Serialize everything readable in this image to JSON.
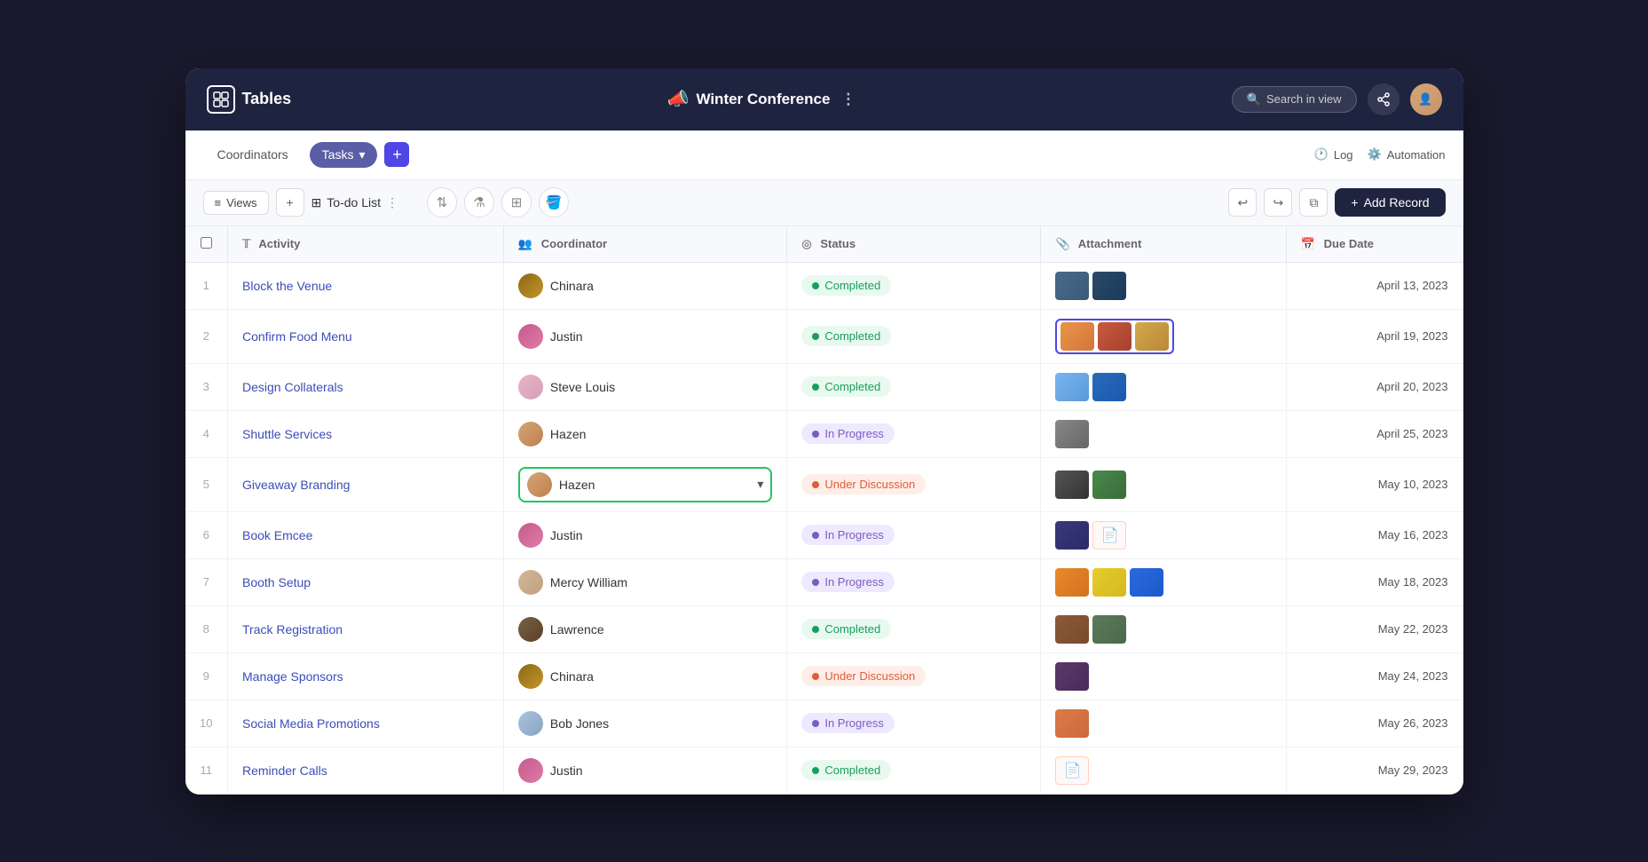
{
  "app": {
    "title": "Tables",
    "window_title": "Winter Conference"
  },
  "header": {
    "title": "Winter Conference",
    "search_placeholder": "Search in view",
    "search_label": "Search in view"
  },
  "tabs": [
    {
      "id": "coordinators",
      "label": "Coordinators",
      "active": false
    },
    {
      "id": "tasks",
      "label": "Tasks",
      "active": true
    }
  ],
  "toolbar_right": {
    "log_label": "Log",
    "automation_label": "Automation"
  },
  "views_toolbar": {
    "views_label": "Views",
    "view_name": "To-do List",
    "add_record_label": "Add Record"
  },
  "table": {
    "columns": [
      {
        "id": "num",
        "label": ""
      },
      {
        "id": "activity",
        "label": "Activity",
        "icon": "T"
      },
      {
        "id": "coordinator",
        "label": "Coordinator",
        "icon": "👤"
      },
      {
        "id": "status",
        "label": "Status",
        "icon": "⊙"
      },
      {
        "id": "attachment",
        "label": "Attachment",
        "icon": "📎"
      },
      {
        "id": "due_date",
        "label": "Due Date",
        "icon": "📅"
      }
    ],
    "rows": [
      {
        "num": 1,
        "activity": "Block the Venue",
        "coordinator": "Chinara",
        "coordinator_avatar": "chinara",
        "status": "Completed",
        "status_type": "completed",
        "attachments": [
          "venue1",
          "venue2"
        ],
        "due_date": "April 13, 2023",
        "selected_attach": false
      },
      {
        "num": 2,
        "activity": "Confirm Food Menu",
        "coordinator": "Justin",
        "coordinator_avatar": "justin",
        "status": "Completed",
        "status_type": "completed",
        "attachments": [
          "food1",
          "food2",
          "food3"
        ],
        "due_date": "April 19, 2023",
        "selected_attach": true
      },
      {
        "num": 3,
        "activity": "Design Collaterals",
        "coordinator": "Steve Louis",
        "coordinator_avatar": "steve",
        "status": "Completed",
        "status_type": "completed",
        "attachments": [
          "design1",
          "design2"
        ],
        "due_date": "April 20, 2023",
        "selected_attach": false
      },
      {
        "num": 4,
        "activity": "Shuttle Services",
        "coordinator": "Hazen",
        "coordinator_avatar": "hazen",
        "status": "In Progress",
        "status_type": "in-progress",
        "attachments": [
          "shuttle"
        ],
        "due_date": "April 25, 2023",
        "selected_attach": false
      },
      {
        "num": 5,
        "activity": "Giveaway Branding",
        "coordinator": "Hazen",
        "coordinator_avatar": "hazen",
        "status": "Under Discussion",
        "status_type": "under-discussion",
        "attachments": [
          "tshirt",
          "bottle"
        ],
        "due_date": "May 10, 2023",
        "selected_attach": false,
        "coordinator_dropdown": true
      },
      {
        "num": 6,
        "activity": "Book Emcee",
        "coordinator": "Justin",
        "coordinator_avatar": "justin",
        "status": "In Progress",
        "status_type": "in-progress",
        "attachments": [
          "emcee",
          "pdf"
        ],
        "due_date": "May 16, 2023",
        "selected_attach": false
      },
      {
        "num": 7,
        "activity": "Booth Setup",
        "coordinator": "Mercy William",
        "coordinator_avatar": "mercy",
        "status": "In Progress",
        "status_type": "in-progress",
        "attachments": [
          "booth1",
          "booth2",
          "booth3"
        ],
        "due_date": "May 18, 2023",
        "selected_attach": false
      },
      {
        "num": 8,
        "activity": "Track Registration",
        "coordinator": "Lawrence",
        "coordinator_avatar": "lawrence",
        "status": "Completed",
        "status_type": "completed",
        "attachments": [
          "reg1",
          "reg2"
        ],
        "due_date": "May 22, 2023",
        "selected_attach": false
      },
      {
        "num": 9,
        "activity": "Manage Sponsors",
        "coordinator": "Chinara",
        "coordinator_avatar": "chinara",
        "status": "Under Discussion",
        "status_type": "under-discussion",
        "attachments": [
          "sponsor"
        ],
        "due_date": "May 24, 2023",
        "selected_attach": false
      },
      {
        "num": 10,
        "activity": "Social Media Promotions",
        "coordinator": "Bob Jones",
        "coordinator_avatar": "bob",
        "status": "In Progress",
        "status_type": "in-progress",
        "attachments": [
          "social"
        ],
        "due_date": "May 26, 2023",
        "selected_attach": false
      },
      {
        "num": 11,
        "activity": "Reminder Calls",
        "coordinator": "Justin",
        "coordinator_avatar": "justin",
        "status": "Completed",
        "status_type": "completed",
        "attachments": [
          "pdf"
        ],
        "due_date": "May 29, 2023",
        "selected_attach": false
      }
    ]
  }
}
